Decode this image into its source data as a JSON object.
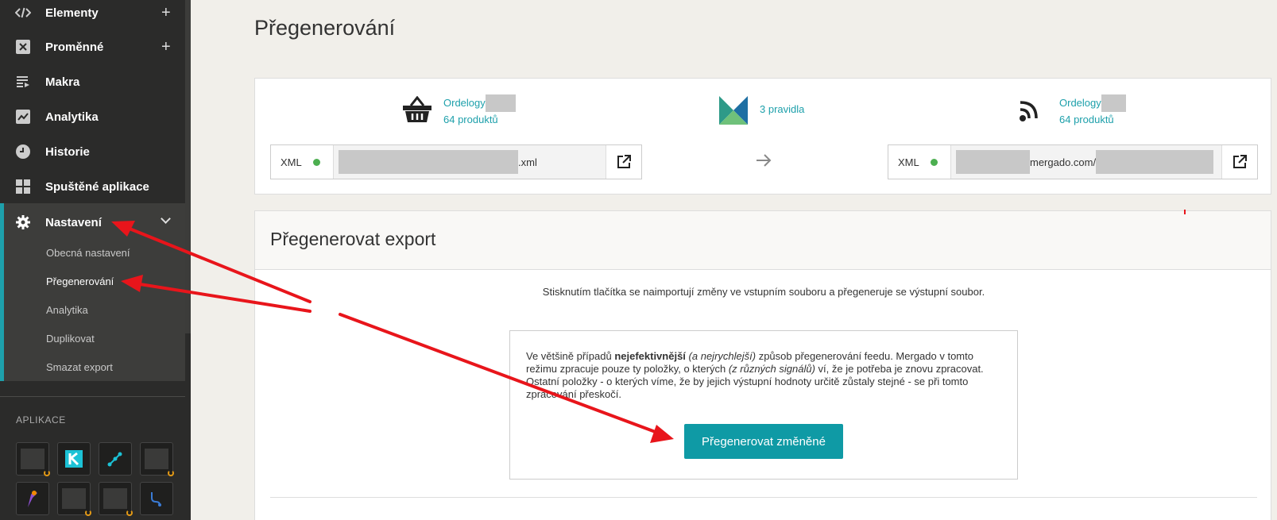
{
  "sidebar": {
    "items": [
      {
        "label": "Elementy",
        "icon": "code-icon",
        "has_plus": true
      },
      {
        "label": "Proměnné",
        "icon": "variable-icon",
        "has_plus": true
      },
      {
        "label": "Makra",
        "icon": "list-icon"
      },
      {
        "label": "Analytika",
        "icon": "chart-icon"
      },
      {
        "label": "Historie",
        "icon": "clock-icon"
      },
      {
        "label": "Spuštěné aplikace",
        "icon": "grid-icon"
      },
      {
        "label": "Nastavení",
        "icon": "gear-icon",
        "expanded": true
      }
    ],
    "plus": "+",
    "settings_sub": [
      {
        "label": "Obecná nastavení"
      },
      {
        "label": "Přegenerování",
        "active": true
      },
      {
        "label": "Analytika"
      },
      {
        "label": "Duplikovat"
      },
      {
        "label": "Smazat export"
      }
    ],
    "apps_title": "APLIKACE"
  },
  "page": {
    "title": "Přegenerování"
  },
  "source": {
    "name": "Ordelogy",
    "count": "64 produktů",
    "xml_tag": "XML",
    "url_suffix": ".xml"
  },
  "rules": {
    "label": "3 pravidla"
  },
  "output": {
    "name": "Ordelogy",
    "count": "64 produktů",
    "xml_tag": "XML",
    "url_mid": "mergado.com/"
  },
  "regen": {
    "title": "Přegenerovat export",
    "intro": "Stisknutím tlačítka se naimportují změny ve vstupním souboru a přegeneruje se výstupní soubor.",
    "info_1": "Ve většině případů ",
    "info_bold": "nejefektivnější",
    "info_2": " ",
    "info_em1": "(a nejrychlejší)",
    "info_3": " způsob přegenerování feedu. Mergado v tomto režimu zpracuje pouze ty položky, o kterých ",
    "info_em2": "(z různých signálů)",
    "info_4": " ví, že je potřeba je znovu zpracovat. Ostatní položky - o kterých víme, že by jejich výstupní hodnoty určitě zůstaly stejné - se při tomto zpracování přeskočí.",
    "button": "Přegenerovat změněné"
  },
  "colors": {
    "accent": "#1ea0ab",
    "button": "#0f9aa5",
    "arrow": "#e8151b",
    "status_ok": "#4caf50"
  }
}
